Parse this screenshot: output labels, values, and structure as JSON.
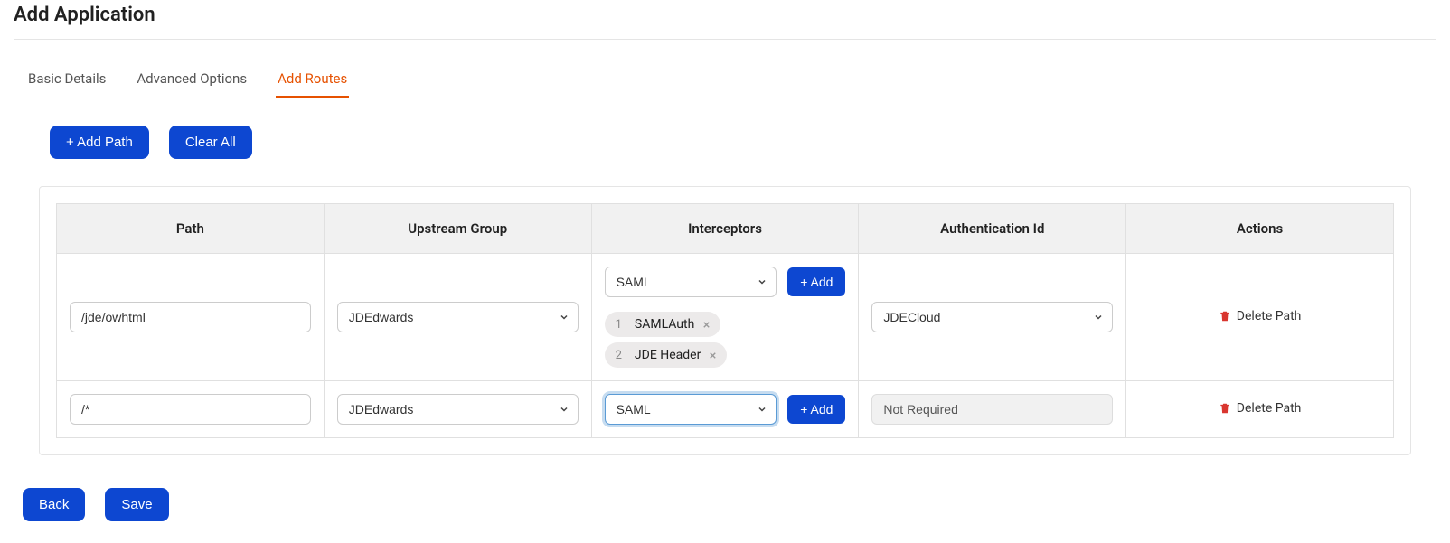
{
  "page_title": "Add Application",
  "tabs": [
    {
      "label": "Basic Details",
      "active": false
    },
    {
      "label": "Advanced Options",
      "active": false
    },
    {
      "label": "Add Routes",
      "active": true
    }
  ],
  "toolbar": {
    "add_path_label": "+ Add Path",
    "clear_all_label": "Clear All"
  },
  "table": {
    "headers": {
      "path": "Path",
      "upstream": "Upstream Group",
      "interceptors": "Interceptors",
      "auth": "Authentication Id",
      "actions": "Actions"
    }
  },
  "rows": [
    {
      "path": "/jde/owhtml",
      "upstream": "JDEdwards",
      "interceptor_select": "SAML",
      "add_btn": "+ Add",
      "chips": [
        {
          "num": "1",
          "label": "SAMLAuth"
        },
        {
          "num": "2",
          "label": "JDE Header"
        }
      ],
      "auth": "JDECloud",
      "auth_disabled": false,
      "delete": "Delete Path"
    },
    {
      "path": "/*",
      "upstream": "JDEdwards",
      "interceptor_select": "SAML",
      "add_btn": "+ Add",
      "chips": [],
      "auth": "Not Required",
      "auth_disabled": true,
      "delete": "Delete Path",
      "focused": true
    }
  ],
  "footer": {
    "back": "Back",
    "save": "Save"
  },
  "colors": {
    "primary": "#0d47d1",
    "accent": "#e65100",
    "danger": "#d9362f"
  }
}
